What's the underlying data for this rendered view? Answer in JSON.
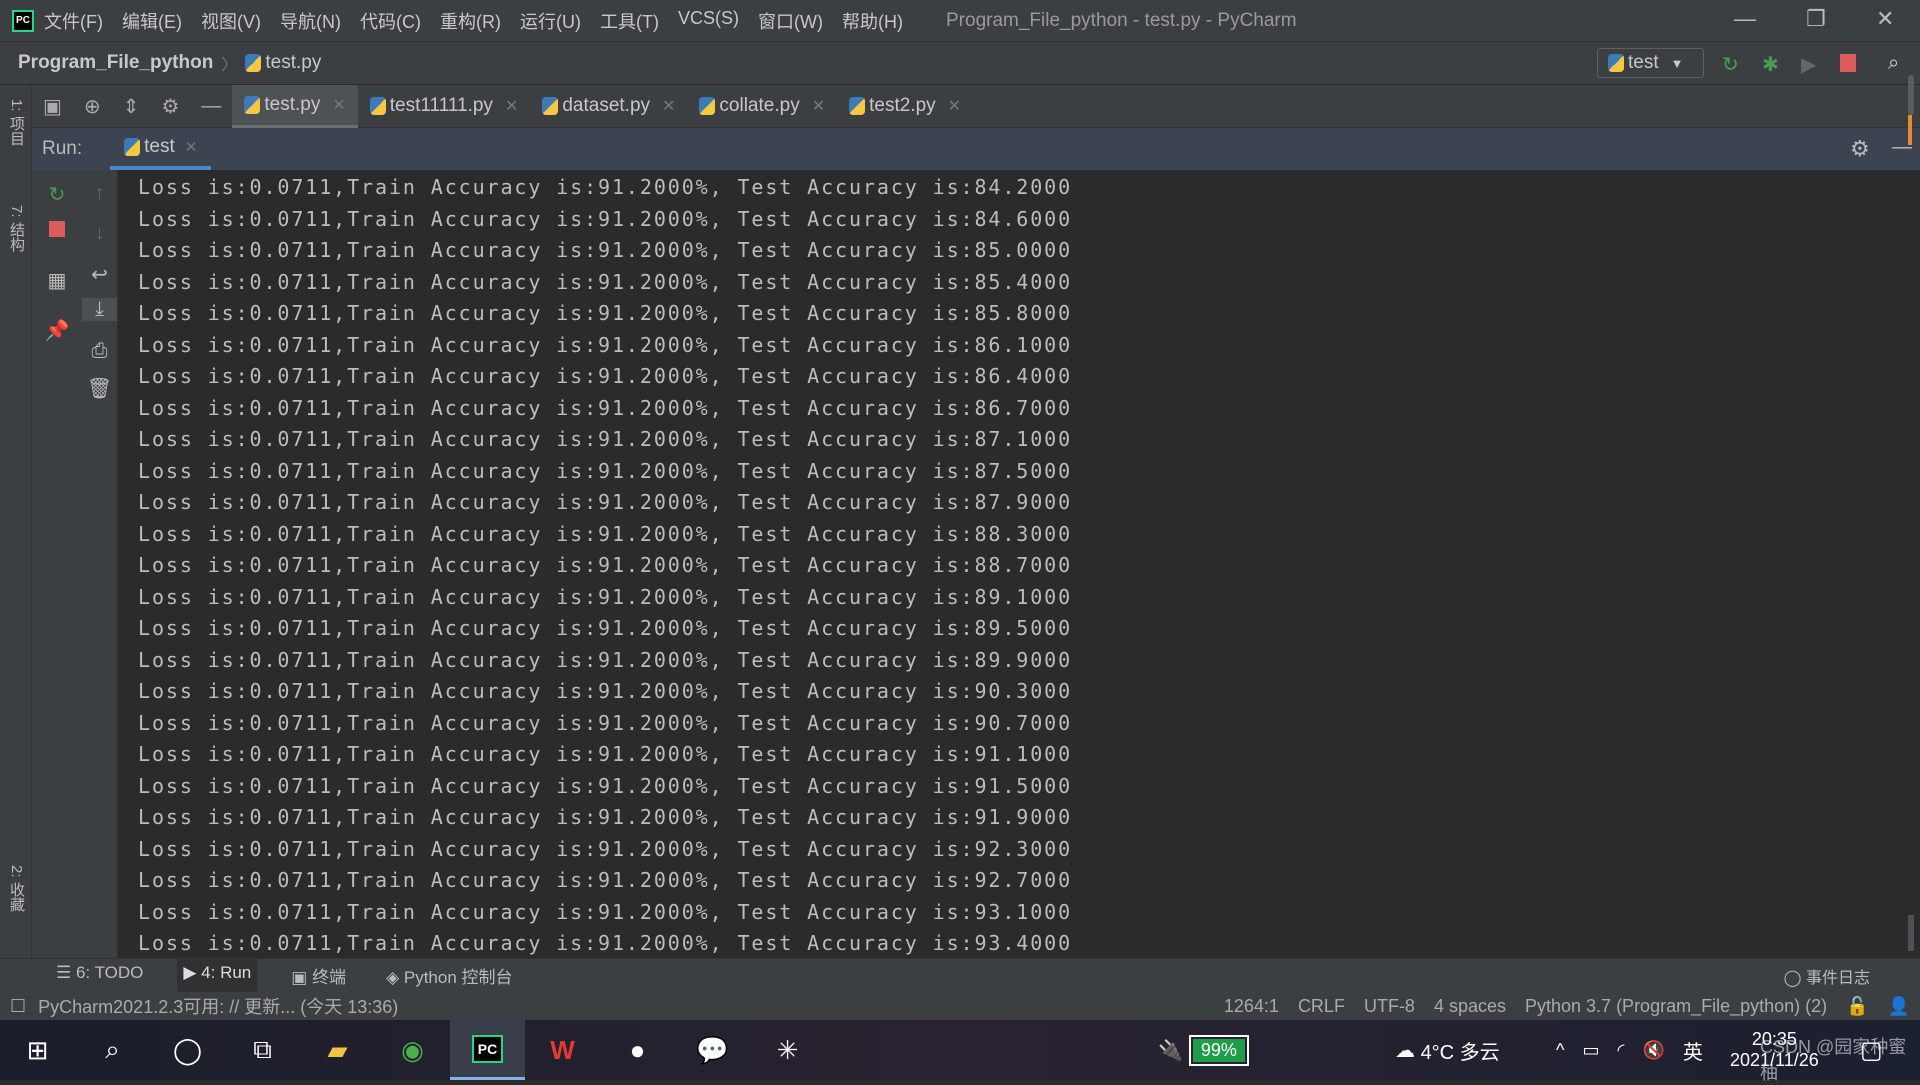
{
  "window": {
    "title": "Program_File_python - test.py - PyCharm",
    "logo": "PC"
  },
  "menu": [
    "文件(F)",
    "编辑(E)",
    "视图(V)",
    "导航(N)",
    "代码(C)",
    "重构(R)",
    "运行(U)",
    "工具(T)",
    "VCS(S)",
    "窗口(W)",
    "帮助(H)"
  ],
  "breadcrumb": {
    "project": "Program_File_python",
    "file": "test.py"
  },
  "run_config": {
    "name": "test"
  },
  "left_strip": {
    "project": "1: 项目",
    "structure": "7: 结构",
    "favorites": "2: 收藏"
  },
  "file_tabs": [
    {
      "label": "test.py",
      "active": true
    },
    {
      "label": "test11111.py"
    },
    {
      "label": "dataset.py"
    },
    {
      "label": "collate.py"
    },
    {
      "label": "test2.py"
    }
  ],
  "run_panel": {
    "label": "Run:",
    "tab": "test"
  },
  "console_lines": [
    "Loss is:0.0711,Train Accuracy is:91.2000%, Test Accuracy is:84.2000",
    "Loss is:0.0711,Train Accuracy is:91.2000%, Test Accuracy is:84.6000",
    "Loss is:0.0711,Train Accuracy is:91.2000%, Test Accuracy is:85.0000",
    "Loss is:0.0711,Train Accuracy is:91.2000%, Test Accuracy is:85.4000",
    "Loss is:0.0711,Train Accuracy is:91.2000%, Test Accuracy is:85.8000",
    "Loss is:0.0711,Train Accuracy is:91.2000%, Test Accuracy is:86.1000",
    "Loss is:0.0711,Train Accuracy is:91.2000%, Test Accuracy is:86.4000",
    "Loss is:0.0711,Train Accuracy is:91.2000%, Test Accuracy is:86.7000",
    "Loss is:0.0711,Train Accuracy is:91.2000%, Test Accuracy is:87.1000",
    "Loss is:0.0711,Train Accuracy is:91.2000%, Test Accuracy is:87.5000",
    "Loss is:0.0711,Train Accuracy is:91.2000%, Test Accuracy is:87.9000",
    "Loss is:0.0711,Train Accuracy is:91.2000%, Test Accuracy is:88.3000",
    "Loss is:0.0711,Train Accuracy is:91.2000%, Test Accuracy is:88.7000",
    "Loss is:0.0711,Train Accuracy is:91.2000%, Test Accuracy is:89.1000",
    "Loss is:0.0711,Train Accuracy is:91.2000%, Test Accuracy is:89.5000",
    "Loss is:0.0711,Train Accuracy is:91.2000%, Test Accuracy is:89.9000",
    "Loss is:0.0711,Train Accuracy is:91.2000%, Test Accuracy is:90.3000",
    "Loss is:0.0711,Train Accuracy is:91.2000%, Test Accuracy is:90.7000",
    "Loss is:0.0711,Train Accuracy is:91.2000%, Test Accuracy is:91.1000",
    "Loss is:0.0711,Train Accuracy is:91.2000%, Test Accuracy is:91.5000",
    "Loss is:0.0711,Train Accuracy is:91.2000%, Test Accuracy is:91.9000",
    "Loss is:0.0711,Train Accuracy is:91.2000%, Test Accuracy is:92.3000",
    "Loss is:0.0711,Train Accuracy is:91.2000%, Test Accuracy is:92.7000",
    "Loss is:0.0711,Train Accuracy is:91.2000%, Test Accuracy is:93.1000",
    "Loss is:0.0711,Train Accuracy is:91.2000%, Test Accuracy is:93.4000"
  ],
  "bottom_tabs": [
    {
      "label": "6: TODO"
    },
    {
      "label": "4: Run",
      "active": true
    },
    {
      "label": "终端"
    },
    {
      "label": "Python 控制台"
    }
  ],
  "event_log": "事件日志",
  "status": {
    "message": "PyCharm2021.2.3可用: // 更新... (今天 13:36)",
    "position": "1264:1",
    "line_sep": "CRLF",
    "encoding": "UTF-8",
    "indent": "4 spaces",
    "interpreter": "Python 3.7 (Program_File_python) (2)"
  },
  "taskbar": {
    "battery": "99%",
    "weather": "4°C 多云",
    "ime": "英",
    "time": "20:35",
    "date": "2021/11/26",
    "watermark": "CSDN @园家种蜜柚"
  },
  "colors": {
    "accent": "#4a88c7",
    "run_green": "#499c54",
    "stop_red": "#db5c5c",
    "battery_green": "#1e9e4a"
  }
}
